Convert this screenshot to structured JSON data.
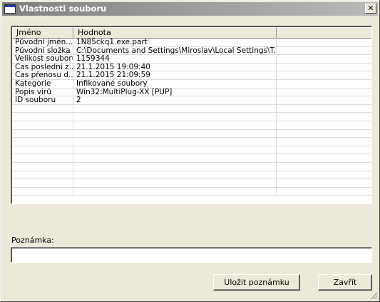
{
  "window": {
    "title": "Vlastnosti souboru",
    "close_glyph": "✕"
  },
  "list": {
    "columns": [
      "Jméno",
      "Hodnota",
      ""
    ],
    "rows": [
      {
        "name": "Původní jmén...",
        "value": "1N85ckq1.exe.part"
      },
      {
        "name": "Původní složka",
        "value": "C:\\Documents and Settings\\Miroslav\\Local Settings\\T..."
      },
      {
        "name": "Velikost souboru",
        "value": "1159344"
      },
      {
        "name": "Čas poslední z...",
        "value": "21.1.2015 19:09:40"
      },
      {
        "name": "Čas přenosu d...",
        "value": "21.1.2015 21:09:59"
      },
      {
        "name": "Kategorie",
        "value": "Infikované soubory"
      },
      {
        "name": "Popis virů",
        "value": "Win32:MultiPlug-XX [PUP]"
      },
      {
        "name": "ID souboru",
        "value": "2"
      }
    ],
    "empty_rows": 11
  },
  "note": {
    "label": "Poznámka:",
    "value": ""
  },
  "buttons": {
    "save_note": "Uložit poznámku",
    "close": "Zavřít"
  },
  "icons": {
    "window": "window-icon",
    "close": "close-icon",
    "grip": "resize-grip-icon"
  }
}
